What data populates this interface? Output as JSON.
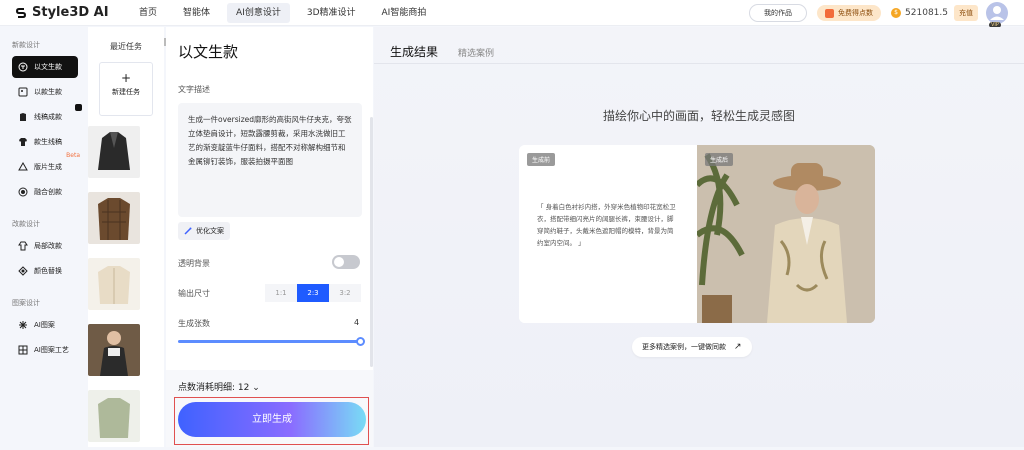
{
  "header": {
    "logo_text": "Style3D AI",
    "nav": [
      {
        "label": "首页"
      },
      {
        "label": "智能体"
      },
      {
        "label": "AI创意设计"
      },
      {
        "label": "3D精准设计"
      },
      {
        "label": "AI智能商拍"
      }
    ],
    "my_works": "我的作品",
    "free_points": "免费得点数",
    "balance": "521081.5",
    "recharge": "充值",
    "vip": "VIP"
  },
  "sidebar": {
    "sections": [
      {
        "title": "新款设计",
        "items": [
          {
            "label": "以文生款",
            "icon": "text-to-design-icon",
            "active": true
          },
          {
            "label": "以款生款",
            "icon": "design-to-design-icon"
          },
          {
            "label": "线稿成款",
            "icon": "sketch-to-design-icon"
          },
          {
            "label": "款生线稿",
            "icon": "design-to-sketch-icon"
          },
          {
            "label": "版片生成",
            "icon": "pattern-icon",
            "badge": "Beta"
          },
          {
            "label": "融合创款",
            "icon": "fusion-icon"
          }
        ]
      },
      {
        "title": "改款设计",
        "items": [
          {
            "label": "局部改款",
            "icon": "local-edit-icon"
          },
          {
            "label": "颜色替换",
            "icon": "color-replace-icon"
          }
        ]
      },
      {
        "title": "图案设计",
        "items": [
          {
            "label": "AI图案",
            "icon": "ai-pattern-icon"
          },
          {
            "label": "AI图案工艺",
            "icon": "ai-craft-icon"
          }
        ]
      }
    ]
  },
  "recent": {
    "title": "最近任务",
    "new_task": "新建任务"
  },
  "form": {
    "title": "以文生款",
    "desc_label": "文字描述",
    "desc_text": "生成一件oversized廓形的高街风牛仔夹克，夸张立体垫肩设计，短款露腰剪裁，采用水洗做旧工艺的渐变靛蓝牛仔面料，搭配不对称解构细节和金属铆钉装饰，服装拍摄平面图",
    "optimize": "优化文案",
    "transparent_bg": "透明背景",
    "transparent_bg_on": false,
    "size_label": "输出尺寸",
    "sizes": [
      "1:1",
      "2:3",
      "3:2"
    ],
    "selected_size": "2:3",
    "count_label": "生成张数",
    "count": "4",
    "cost": "点数消耗明细: 12",
    "generate": "立即生成"
  },
  "main": {
    "tab_result": "生成结果",
    "tab_cases": "精选案例",
    "slogan": "描绘你心中的画面，轻松生成灵感图",
    "before_tag": "生成前",
    "after_tag": "生成后",
    "quote": "「 身着白色衬衫内搭，外穿米色植物印花宽松卫衣，搭配带细闪亮片的阔腿长裤，束腰设计，脚穿简约鞋子，头戴米色遮阳帽的模特，背景为简约室内空间。 」",
    "more_cases": "更多精选案例，一键做同款",
    "colors": {
      "accent": "#1f5bff",
      "highlight_border": "#e05050"
    }
  }
}
